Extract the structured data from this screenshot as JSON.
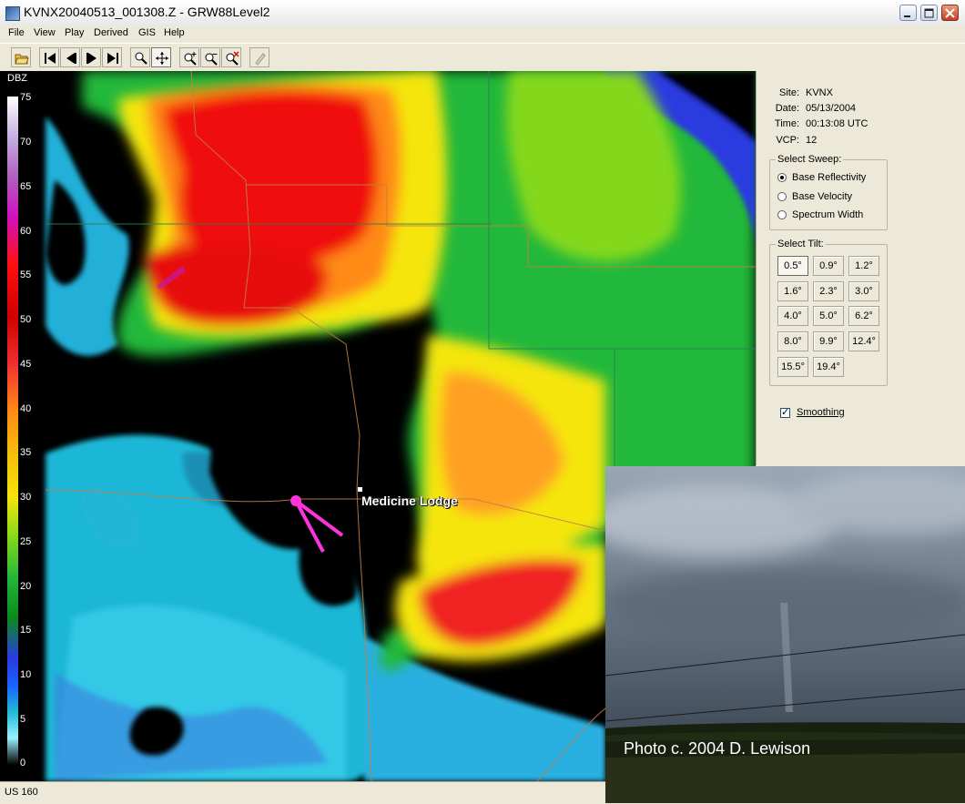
{
  "window": {
    "title": "KVNX20040513_001308.Z - GRW88Level2",
    "controls": [
      "minimize-icon",
      "maximize-icon",
      "close-icon"
    ]
  },
  "menu": [
    "File",
    "View",
    "Play",
    "Derived",
    "GIS",
    "Help"
  ],
  "toolbar": {
    "buttons": [
      "open-folder-icon",
      "first-frame-icon",
      "step-back-icon",
      "step-forward-icon",
      "last-frame-icon",
      "zoom-tool-icon",
      "pan-tool-icon",
      "zoom-in-icon",
      "zoom-out-icon",
      "zoom-reset-icon",
      "pencil-icon"
    ]
  },
  "legend": {
    "title": "DBZ",
    "ticks": [
      "75",
      "70",
      "65",
      "60",
      "55",
      "50",
      "45",
      "40",
      "35",
      "30",
      "25",
      "20",
      "15",
      "10",
      "5",
      "0"
    ]
  },
  "map": {
    "city_label": "Medicine Lodge"
  },
  "info": {
    "site_label": "Site:",
    "site": "KVNX",
    "date_label": "Date:",
    "date": "05/13/2004",
    "time_label": "Time:",
    "time": "00:13:08 UTC",
    "vcp_label": "VCP:",
    "vcp": "12"
  },
  "sweep": {
    "legend": "Select Sweep:",
    "options": [
      "Base Reflectivity",
      "Base Velocity",
      "Spectrum Width"
    ],
    "selected": "Base Reflectivity"
  },
  "tilt": {
    "legend": "Select Tilt:",
    "options": [
      "0.5°",
      "0.9°",
      "1.2°",
      "1.6°",
      "2.3°",
      "3.0°",
      "4.0°",
      "5.0°",
      "6.2°",
      "8.0°",
      "9.9°",
      "12.4°",
      "15.5°",
      "19.4°"
    ],
    "selected": "0.5°"
  },
  "smoothing": {
    "label": "Smoothing",
    "checked": true
  },
  "photo": {
    "caption": "Photo c. 2004 D. Lewison"
  },
  "status": {
    "text": "US 160"
  }
}
